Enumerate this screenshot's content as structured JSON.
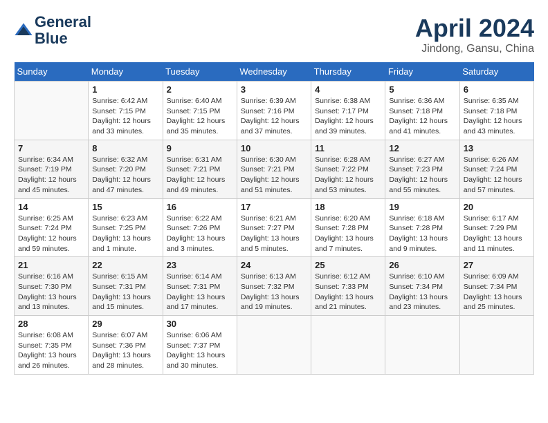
{
  "header": {
    "logo_line1": "General",
    "logo_line2": "Blue",
    "month_title": "April 2024",
    "location": "Jindong, Gansu, China"
  },
  "days_of_week": [
    "Sunday",
    "Monday",
    "Tuesday",
    "Wednesday",
    "Thursday",
    "Friday",
    "Saturday"
  ],
  "weeks": [
    [
      {
        "num": "",
        "info": ""
      },
      {
        "num": "1",
        "info": "Sunrise: 6:42 AM\nSunset: 7:15 PM\nDaylight: 12 hours\nand 33 minutes."
      },
      {
        "num": "2",
        "info": "Sunrise: 6:40 AM\nSunset: 7:15 PM\nDaylight: 12 hours\nand 35 minutes."
      },
      {
        "num": "3",
        "info": "Sunrise: 6:39 AM\nSunset: 7:16 PM\nDaylight: 12 hours\nand 37 minutes."
      },
      {
        "num": "4",
        "info": "Sunrise: 6:38 AM\nSunset: 7:17 PM\nDaylight: 12 hours\nand 39 minutes."
      },
      {
        "num": "5",
        "info": "Sunrise: 6:36 AM\nSunset: 7:18 PM\nDaylight: 12 hours\nand 41 minutes."
      },
      {
        "num": "6",
        "info": "Sunrise: 6:35 AM\nSunset: 7:18 PM\nDaylight: 12 hours\nand 43 minutes."
      }
    ],
    [
      {
        "num": "7",
        "info": "Sunrise: 6:34 AM\nSunset: 7:19 PM\nDaylight: 12 hours\nand 45 minutes."
      },
      {
        "num": "8",
        "info": "Sunrise: 6:32 AM\nSunset: 7:20 PM\nDaylight: 12 hours\nand 47 minutes."
      },
      {
        "num": "9",
        "info": "Sunrise: 6:31 AM\nSunset: 7:21 PM\nDaylight: 12 hours\nand 49 minutes."
      },
      {
        "num": "10",
        "info": "Sunrise: 6:30 AM\nSunset: 7:21 PM\nDaylight: 12 hours\nand 51 minutes."
      },
      {
        "num": "11",
        "info": "Sunrise: 6:28 AM\nSunset: 7:22 PM\nDaylight: 12 hours\nand 53 minutes."
      },
      {
        "num": "12",
        "info": "Sunrise: 6:27 AM\nSunset: 7:23 PM\nDaylight: 12 hours\nand 55 minutes."
      },
      {
        "num": "13",
        "info": "Sunrise: 6:26 AM\nSunset: 7:24 PM\nDaylight: 12 hours\nand 57 minutes."
      }
    ],
    [
      {
        "num": "14",
        "info": "Sunrise: 6:25 AM\nSunset: 7:24 PM\nDaylight: 12 hours\nand 59 minutes."
      },
      {
        "num": "15",
        "info": "Sunrise: 6:23 AM\nSunset: 7:25 PM\nDaylight: 13 hours\nand 1 minute."
      },
      {
        "num": "16",
        "info": "Sunrise: 6:22 AM\nSunset: 7:26 PM\nDaylight: 13 hours\nand 3 minutes."
      },
      {
        "num": "17",
        "info": "Sunrise: 6:21 AM\nSunset: 7:27 PM\nDaylight: 13 hours\nand 5 minutes."
      },
      {
        "num": "18",
        "info": "Sunrise: 6:20 AM\nSunset: 7:28 PM\nDaylight: 13 hours\nand 7 minutes."
      },
      {
        "num": "19",
        "info": "Sunrise: 6:18 AM\nSunset: 7:28 PM\nDaylight: 13 hours\nand 9 minutes."
      },
      {
        "num": "20",
        "info": "Sunrise: 6:17 AM\nSunset: 7:29 PM\nDaylight: 13 hours\nand 11 minutes."
      }
    ],
    [
      {
        "num": "21",
        "info": "Sunrise: 6:16 AM\nSunset: 7:30 PM\nDaylight: 13 hours\nand 13 minutes."
      },
      {
        "num": "22",
        "info": "Sunrise: 6:15 AM\nSunset: 7:31 PM\nDaylight: 13 hours\nand 15 minutes."
      },
      {
        "num": "23",
        "info": "Sunrise: 6:14 AM\nSunset: 7:31 PM\nDaylight: 13 hours\nand 17 minutes."
      },
      {
        "num": "24",
        "info": "Sunrise: 6:13 AM\nSunset: 7:32 PM\nDaylight: 13 hours\nand 19 minutes."
      },
      {
        "num": "25",
        "info": "Sunrise: 6:12 AM\nSunset: 7:33 PM\nDaylight: 13 hours\nand 21 minutes."
      },
      {
        "num": "26",
        "info": "Sunrise: 6:10 AM\nSunset: 7:34 PM\nDaylight: 13 hours\nand 23 minutes."
      },
      {
        "num": "27",
        "info": "Sunrise: 6:09 AM\nSunset: 7:34 PM\nDaylight: 13 hours\nand 25 minutes."
      }
    ],
    [
      {
        "num": "28",
        "info": "Sunrise: 6:08 AM\nSunset: 7:35 PM\nDaylight: 13 hours\nand 26 minutes."
      },
      {
        "num": "29",
        "info": "Sunrise: 6:07 AM\nSunset: 7:36 PM\nDaylight: 13 hours\nand 28 minutes."
      },
      {
        "num": "30",
        "info": "Sunrise: 6:06 AM\nSunset: 7:37 PM\nDaylight: 13 hours\nand 30 minutes."
      },
      {
        "num": "",
        "info": ""
      },
      {
        "num": "",
        "info": ""
      },
      {
        "num": "",
        "info": ""
      },
      {
        "num": "",
        "info": ""
      }
    ]
  ]
}
